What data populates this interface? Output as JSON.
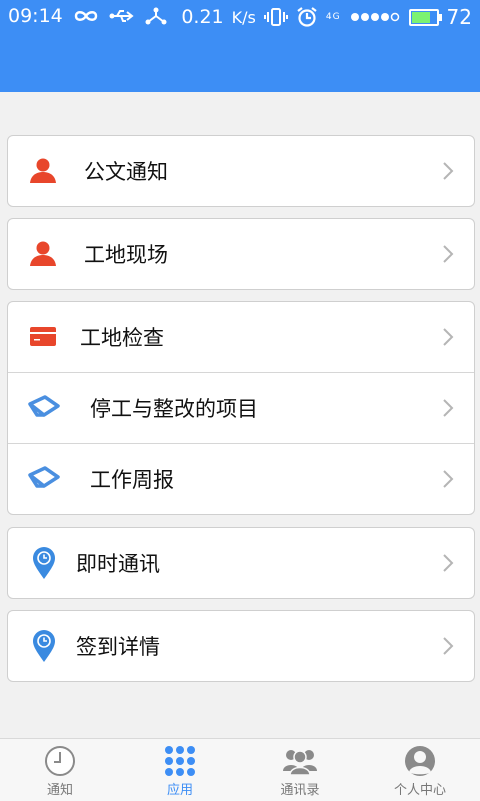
{
  "status_bar": {
    "time": "09:14",
    "net_speed": "0.21",
    "net_unit": "K/s",
    "network": "4G",
    "battery": "72",
    "battery_level": 0.72
  },
  "menu": {
    "groups": [
      {
        "items": [
          {
            "label": "公文通知",
            "icon": "person-icon",
            "color": "#e8462b"
          }
        ]
      },
      {
        "items": [
          {
            "label": "工地现场",
            "icon": "person-icon",
            "color": "#e8462b"
          }
        ]
      },
      {
        "items": [
          {
            "label": "工地检查",
            "icon": "card-icon",
            "color": "#e8462b"
          },
          {
            "label": "停工与整改的项目",
            "icon": "tag-icon",
            "color": "#4a8fe0"
          },
          {
            "label": "工作周报",
            "icon": "tag-icon",
            "color": "#4a8fe0"
          }
        ]
      },
      {
        "items": [
          {
            "label": "即时通讯",
            "icon": "clock-pin-icon",
            "color": "#3a8ae0"
          }
        ]
      },
      {
        "items": [
          {
            "label": "签到详情",
            "icon": "clock-pin-icon",
            "color": "#3a8ae0"
          }
        ]
      }
    ]
  },
  "tabs": [
    {
      "label": "通知",
      "icon": "clock-icon",
      "active": false
    },
    {
      "label": "应用",
      "icon": "apps-grid-icon",
      "active": true
    },
    {
      "label": "通讯录",
      "icon": "contacts-icon",
      "active": false
    },
    {
      "label": "个人中心",
      "icon": "profile-icon",
      "active": false
    }
  ],
  "colors": {
    "primary": "#3d8ef5",
    "red": "#e8462b",
    "blue": "#4a8fe0"
  }
}
